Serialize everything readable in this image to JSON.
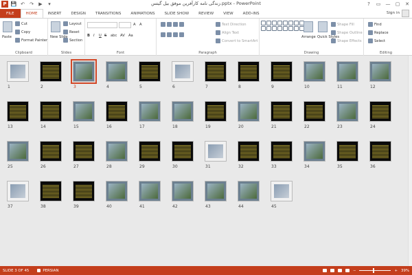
{
  "window": {
    "title": "زندگی نامه کارآفرین موفق بیل گیتس.pptx - PowerPoint",
    "controls": [
      "?",
      "▭",
      "—",
      "▢",
      "✕"
    ]
  },
  "qat": {
    "logo": "P",
    "save": "💾",
    "undo": "↶",
    "redo": "↷",
    "start": "▶",
    "customize": "▾"
  },
  "tabs": [
    "FILE",
    "HOME",
    "INSERT",
    "DESIGN",
    "TRANSITIONS",
    "ANIMATIONS",
    "SLIDE SHOW",
    "REVIEW",
    "VIEW",
    "ADD-INS"
  ],
  "account": {
    "signin": "Sign in"
  },
  "ribbon": {
    "clipboard": {
      "label": "Clipboard",
      "paste": "Paste",
      "cut": "Cut",
      "copy": "Copy",
      "format_painter": "Format Painter"
    },
    "slides": {
      "label": "Slides",
      "new_slide": "New Slide",
      "layout": "Layout",
      "reset": "Reset",
      "section": "Section"
    },
    "font": {
      "label": "Font",
      "font_size_up": "A",
      "font_size_down": "A",
      "bold": "B",
      "italic": "I",
      "underline": "U",
      "strike": "S",
      "shadow": "abc",
      "spacing": "AV",
      "case": "Aa"
    },
    "paragraph": {
      "label": "Paragraph",
      "text_direction": "Text Direction",
      "align_text": "Align Text",
      "convert_smartart": "Convert to SmartArt"
    },
    "drawing": {
      "label": "Drawing",
      "arrange": "Arrange",
      "quick_styles": "Quick Styles",
      "shape_fill": "Shape Fill",
      "shape_outline": "Shape Outline",
      "shape_effects": "Shape Effects"
    },
    "editing": {
      "label": "Editing",
      "find": "Find",
      "replace": "Replace",
      "select": "Select"
    }
  },
  "slides": {
    "selected": 3,
    "items": [
      {
        "n": "1",
        "kind": "white"
      },
      {
        "n": "2",
        "kind": "text"
      },
      {
        "n": "3",
        "kind": "photo"
      },
      {
        "n": "4",
        "kind": "photo"
      },
      {
        "n": "5",
        "kind": "text"
      },
      {
        "n": "6",
        "kind": "white"
      },
      {
        "n": "7",
        "kind": "text"
      },
      {
        "n": "8",
        "kind": "text"
      },
      {
        "n": "9",
        "kind": "text"
      },
      {
        "n": "10",
        "kind": "photo"
      },
      {
        "n": "11",
        "kind": "photo"
      },
      {
        "n": "12",
        "kind": "photo"
      },
      {
        "n": "13",
        "kind": "text"
      },
      {
        "n": "14",
        "kind": "text"
      },
      {
        "n": "15",
        "kind": "photo"
      },
      {
        "n": "16",
        "kind": "text"
      },
      {
        "n": "17",
        "kind": "photo"
      },
      {
        "n": "18",
        "kind": "photo"
      },
      {
        "n": "19",
        "kind": "text"
      },
      {
        "n": "20",
        "kind": "photo"
      },
      {
        "n": "21",
        "kind": "text"
      },
      {
        "n": "22",
        "kind": "text"
      },
      {
        "n": "23",
        "kind": "photo"
      },
      {
        "n": "24",
        "kind": "text"
      },
      {
        "n": "25",
        "kind": "photo"
      },
      {
        "n": "26",
        "kind": "text"
      },
      {
        "n": "27",
        "kind": "text"
      },
      {
        "n": "28",
        "kind": "photo"
      },
      {
        "n": "29",
        "kind": "text"
      },
      {
        "n": "30",
        "kind": "text"
      },
      {
        "n": "31",
        "kind": "white"
      },
      {
        "n": "32",
        "kind": "text"
      },
      {
        "n": "33",
        "kind": "text"
      },
      {
        "n": "34",
        "kind": "photo"
      },
      {
        "n": "35",
        "kind": "text"
      },
      {
        "n": "36",
        "kind": "text"
      },
      {
        "n": "37",
        "kind": "white"
      },
      {
        "n": "38",
        "kind": "text"
      },
      {
        "n": "39",
        "kind": "text"
      },
      {
        "n": "40",
        "kind": "photo"
      },
      {
        "n": "41",
        "kind": "photo"
      },
      {
        "n": "42",
        "kind": "photo"
      },
      {
        "n": "43",
        "kind": "photo"
      },
      {
        "n": "44",
        "kind": "photo"
      },
      {
        "n": "45",
        "kind": "white"
      }
    ]
  },
  "status": {
    "slide_info": "SLIDE 3 OF 45",
    "language": "PERSIAN",
    "zoom": "39%",
    "minus": "−",
    "plus": "+"
  },
  "colors": {
    "accent": "#c43e1c",
    "selection": "#d24726"
  }
}
